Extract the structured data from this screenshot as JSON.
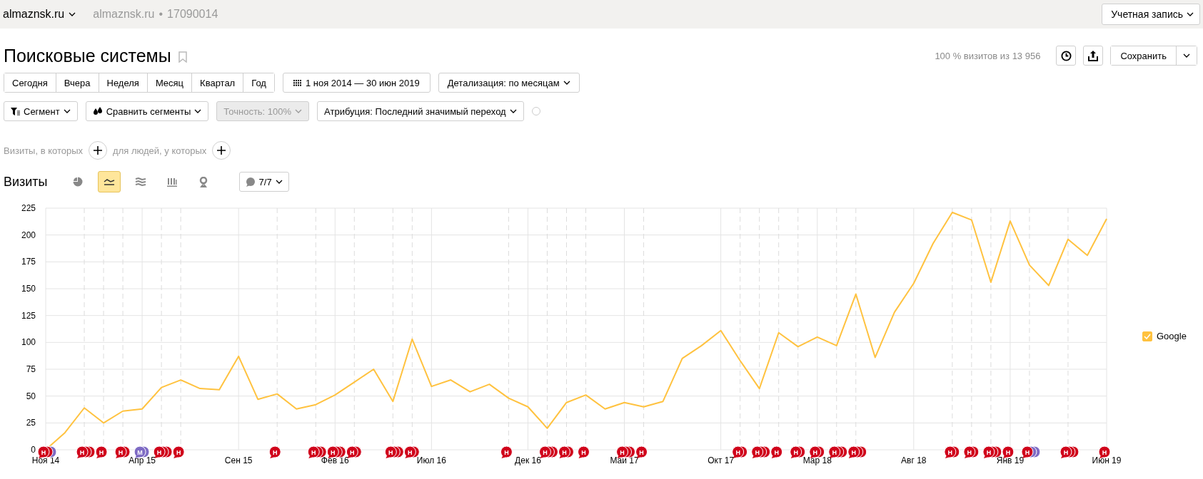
{
  "header": {
    "site": "almaznsk.ru",
    "site_name": "almaznsk.ru",
    "separator": "•",
    "counter_id": "17090014",
    "account": "Учетная запись"
  },
  "title": "Поисковые системы",
  "summary": "100 % визитов из 13 956",
  "save": "Сохранить",
  "periods": [
    {
      "label": "Сегодня",
      "selected": false
    },
    {
      "label": "Вчера",
      "selected": false
    },
    {
      "label": "Неделя",
      "selected": false
    },
    {
      "label": "Месяц",
      "selected": false
    },
    {
      "label": "Квартал",
      "selected": false
    },
    {
      "label": "Год",
      "selected": false
    }
  ],
  "date_range": "1 ноя 2014 — 30 июн 2019",
  "detail": "Детализация: по месяцам",
  "filters": [
    {
      "kind": "segment",
      "label": "Сегмент",
      "disabled": false
    },
    {
      "kind": "compare",
      "label": "Сравнить сегменты",
      "disabled": false
    },
    {
      "kind": "plain",
      "label": "Точность: 100%",
      "disabled": true
    },
    {
      "kind": "plain",
      "label": "Атрибуция: Последний значимый переход",
      "disabled": false
    }
  ],
  "conditions": [
    "Визиты, в которых",
    "для людей, у которых"
  ],
  "visits": {
    "title": "Визиты",
    "chart_types": [
      {
        "kind": "pie",
        "selected": false
      },
      {
        "kind": "line",
        "selected": true
      },
      {
        "kind": "area",
        "selected": false
      },
      {
        "kind": "bars",
        "selected": false
      },
      {
        "kind": "map",
        "selected": false
      }
    ],
    "notes": "7/7"
  },
  "chart": {
    "chart_data": {
      "type": "line",
      "grid": true,
      "categories": [
        "Ноя 14",
        null,
        null,
        null,
        null,
        "Апр 15",
        null,
        null,
        null,
        null,
        "Сен 15",
        null,
        null,
        null,
        null,
        "Фев 16",
        null,
        null,
        null,
        null,
        "Июл 16",
        null,
        null,
        null,
        null,
        "Дек 16",
        null,
        null,
        null,
        null,
        "Май 17",
        null,
        null,
        null,
        null,
        "Окт 17",
        null,
        null,
        null,
        null,
        "Мар 18",
        null,
        null,
        null,
        null,
        "Авг 18",
        null,
        null,
        null,
        null,
        "Янв 19",
        null,
        null,
        null,
        null,
        "Июн 19"
      ],
      "series": [
        {
          "name": "Google",
          "color": "#ffc23f",
          "values": [
            0,
            16,
            39,
            25,
            36,
            38,
            58,
            65,
            57,
            56,
            87,
            47,
            52,
            38,
            42,
            51,
            63,
            75,
            45,
            103,
            59,
            65,
            54,
            61,
            48,
            40,
            20,
            44,
            51,
            38,
            44,
            40,
            45,
            85,
            97,
            111,
            83,
            57,
            109,
            96,
            105,
            97,
            145,
            86,
            128,
            155,
            192,
            221,
            214,
            156,
            213,
            172,
            153,
            196,
            181,
            215
          ]
        }
      ],
      "ylim": [
        0,
        225
      ],
      "yticks": [
        0,
        25,
        50,
        75,
        100,
        125,
        150,
        175,
        200,
        225
      ]
    },
    "note_slots": [
      {
        "kind": "notes",
        "text": "Н",
        "markers": [
          {
            "color": "#d0021b"
          },
          {
            "color": "#d0021b"
          },
          {
            "color": "#7e6bc4"
          }
        ]
      },
      {
        "kind": "none"
      },
      {
        "kind": "notes",
        "text": "Н",
        "markers": [
          {
            "color": "#d0021b"
          },
          {
            "color": "#d0021b"
          },
          {
            "color": "#d0021b"
          }
        ]
      },
      {
        "kind": "notes",
        "text": "Н",
        "markers": [
          {
            "color": "#d0021b"
          }
        ]
      },
      {
        "kind": "notes",
        "text": "Н",
        "markers": [
          {
            "color": "#d0021b"
          },
          {
            "color": "#d0021b"
          }
        ]
      },
      {
        "kind": "notes",
        "text": "М",
        "markers": [
          {
            "color": "#7e6bc4"
          },
          {
            "color": "#7e6bc4"
          }
        ]
      },
      {
        "kind": "notes",
        "text": "Н",
        "markers": [
          {
            "color": "#d0021b"
          },
          {
            "color": "#d0021b"
          },
          {
            "color": "#d0021b"
          }
        ]
      },
      {
        "kind": "notes",
        "text": "Н",
        "markers": [
          {
            "color": "#d0021b"
          }
        ]
      },
      {
        "kind": "none"
      },
      {
        "kind": "none"
      },
      {
        "kind": "none"
      },
      {
        "kind": "none"
      },
      {
        "kind": "notes",
        "text": "Н",
        "markers": [
          {
            "color": "#d0021b"
          }
        ]
      },
      {
        "kind": "none"
      },
      {
        "kind": "notes",
        "text": "Н",
        "markers": [
          {
            "color": "#d0021b"
          },
          {
            "color": "#d0021b"
          },
          {
            "color": "#d0021b"
          }
        ]
      },
      {
        "kind": "notes",
        "text": "Н",
        "markers": [
          {
            "color": "#d0021b"
          },
          {
            "color": "#d0021b"
          },
          {
            "color": "#d0021b"
          }
        ]
      },
      {
        "kind": "notes",
        "text": "Н",
        "markers": [
          {
            "color": "#d0021b"
          },
          {
            "color": "#d0021b"
          }
        ]
      },
      {
        "kind": "none"
      },
      {
        "kind": "notes",
        "text": "Н",
        "markers": [
          {
            "color": "#d0021b"
          },
          {
            "color": "#d0021b"
          },
          {
            "color": "#d0021b"
          }
        ]
      },
      {
        "kind": "notes",
        "text": "Н",
        "markers": [
          {
            "color": "#d0021b"
          },
          {
            "color": "#d0021b"
          }
        ]
      },
      {
        "kind": "none"
      },
      {
        "kind": "none"
      },
      {
        "kind": "none"
      },
      {
        "kind": "none"
      },
      {
        "kind": "notes",
        "text": "Н",
        "markers": [
          {
            "color": "#d0021b"
          }
        ]
      },
      {
        "kind": "none"
      },
      {
        "kind": "notes",
        "text": "Н",
        "markers": [
          {
            "color": "#d0021b"
          },
          {
            "color": "#d0021b"
          },
          {
            "color": "#d0021b"
          }
        ]
      },
      {
        "kind": "notes",
        "text": "Н",
        "markers": [
          {
            "color": "#d0021b"
          },
          {
            "color": "#d0021b"
          }
        ]
      },
      {
        "kind": "notes",
        "text": "Н",
        "markers": [
          {
            "color": "#d0021b"
          }
        ]
      },
      {
        "kind": "none"
      },
      {
        "kind": "notes",
        "text": "Н",
        "markers": [
          {
            "color": "#d0021b"
          },
          {
            "color": "#d0021b"
          },
          {
            "color": "#d0021b"
          }
        ]
      },
      {
        "kind": "notes",
        "text": "Н",
        "markers": [
          {
            "color": "#d0021b"
          }
        ]
      },
      {
        "kind": "none"
      },
      {
        "kind": "none"
      },
      {
        "kind": "none"
      },
      {
        "kind": "none"
      },
      {
        "kind": "notes",
        "text": "Н",
        "markers": [
          {
            "color": "#d0021b"
          },
          {
            "color": "#d0021b"
          }
        ]
      },
      {
        "kind": "notes",
        "text": "Н",
        "markers": [
          {
            "color": "#d0021b"
          },
          {
            "color": "#d0021b"
          },
          {
            "color": "#d0021b"
          }
        ]
      },
      {
        "kind": "notes",
        "text": "Н",
        "markers": [
          {
            "color": "#d0021b"
          }
        ]
      },
      {
        "kind": "notes",
        "text": "Н",
        "markers": [
          {
            "color": "#d0021b"
          },
          {
            "color": "#d0021b"
          }
        ]
      },
      {
        "kind": "notes",
        "text": "Н",
        "markers": [
          {
            "color": "#d0021b"
          },
          {
            "color": "#d0021b"
          }
        ]
      },
      {
        "kind": "notes",
        "text": "Н",
        "markers": [
          {
            "color": "#d0021b"
          },
          {
            "color": "#d0021b"
          },
          {
            "color": "#d0021b"
          }
        ]
      },
      {
        "kind": "notes",
        "text": "Н",
        "markers": [
          {
            "color": "#d0021b"
          },
          {
            "color": "#d0021b"
          },
          {
            "color": "#d0021b"
          }
        ]
      },
      {
        "kind": "none"
      },
      {
        "kind": "none"
      },
      {
        "kind": "none"
      },
      {
        "kind": "none"
      },
      {
        "kind": "notes",
        "text": "Н",
        "markers": [
          {
            "color": "#d0021b"
          },
          {
            "color": "#d0021b"
          }
        ]
      },
      {
        "kind": "notes",
        "text": "Н",
        "markers": [
          {
            "color": "#d0021b"
          },
          {
            "color": "#d0021b"
          }
        ]
      },
      {
        "kind": "notes",
        "text": "Н",
        "markers": [
          {
            "color": "#d0021b"
          },
          {
            "color": "#d0021b"
          },
          {
            "color": "#d0021b"
          }
        ]
      },
      {
        "kind": "notes",
        "text": "Н",
        "markers": [
          {
            "color": "#d0021b"
          }
        ]
      },
      {
        "kind": "notes",
        "text": "Н",
        "markers": [
          {
            "color": "#d0021b"
          },
          {
            "color": "#7e6bc4"
          },
          {
            "color": "#7e6bc4"
          }
        ]
      },
      {
        "kind": "none"
      },
      {
        "kind": "notes",
        "text": "Н",
        "markers": [
          {
            "color": "#d0021b"
          },
          {
            "color": "#d0021b"
          },
          {
            "color": "#d0021b"
          }
        ]
      },
      {
        "kind": "none"
      },
      {
        "kind": "notes",
        "text": "Н",
        "markers": [
          {
            "color": "#d0021b"
          }
        ]
      }
    ],
    "legend": [
      {
        "checked": true
      }
    ]
  }
}
